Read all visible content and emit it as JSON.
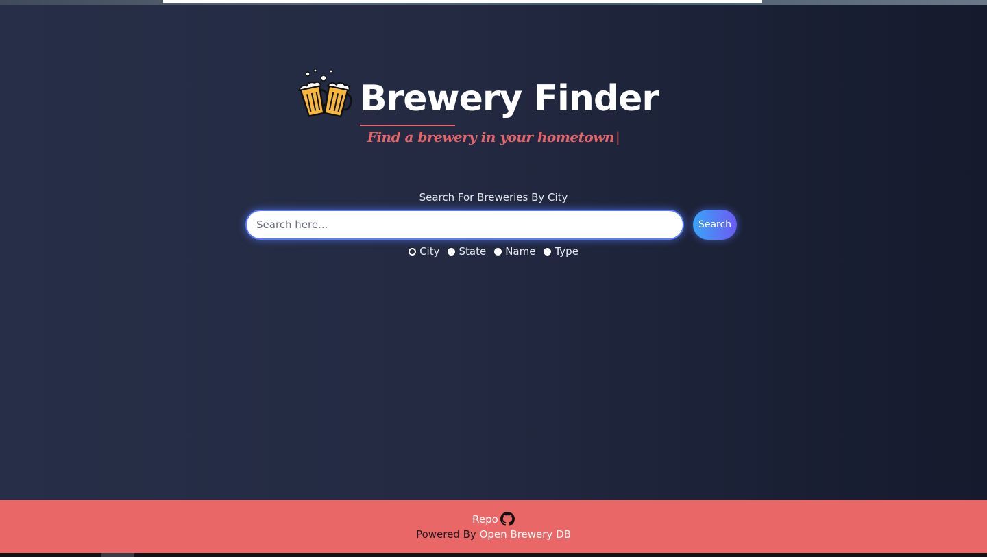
{
  "app": {
    "title": "Brewery Finder",
    "tagline": "Find a brewery in your hometown",
    "tagline_cursor": "|"
  },
  "search": {
    "label": "Search For Breweries By City",
    "placeholder": "Search here...",
    "value": "",
    "button_label": "Search",
    "options": [
      {
        "label": "City",
        "selected": true
      },
      {
        "label": "State",
        "selected": false
      },
      {
        "label": "Name",
        "selected": false
      },
      {
        "label": "Type",
        "selected": false
      }
    ]
  },
  "footer": {
    "repo_label": "Repo",
    "repo_icon": "github-icon",
    "powered_prefix": "Powered By",
    "powered_link": "Open Brewery DB"
  },
  "colors": {
    "accent": "#e96767",
    "title": "#ffffff",
    "tagline": "#e46468",
    "button_gradient_start": "#3aa3f7",
    "button_gradient_end": "#6b5cf2",
    "background": "#232a42"
  }
}
